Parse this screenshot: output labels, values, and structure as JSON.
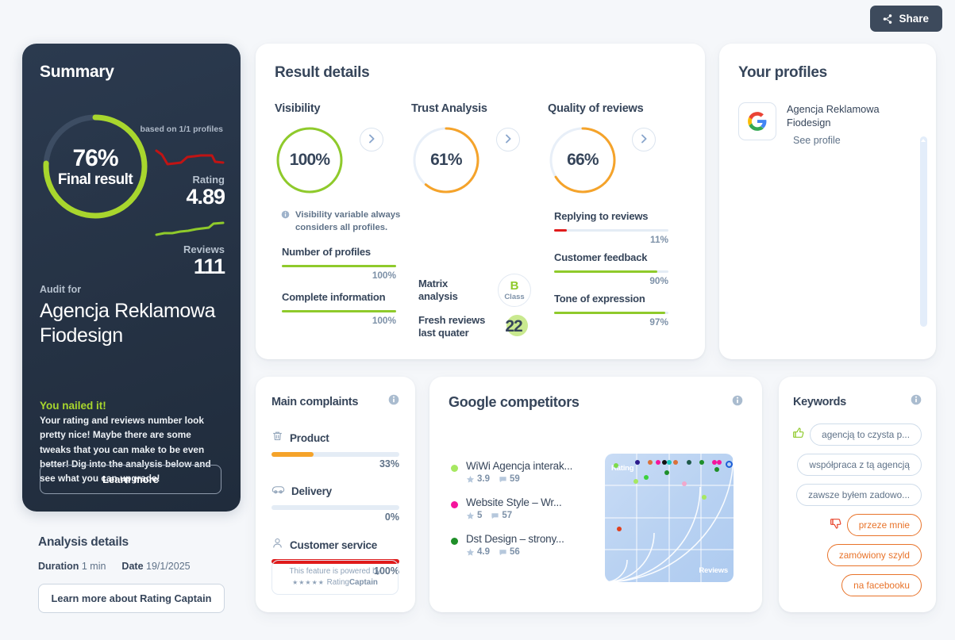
{
  "topbar": {
    "share_label": "Share",
    "share_icon": "share-icon"
  },
  "summary": {
    "title": "Summary",
    "based_on": "based on 1/1 profiles",
    "final_percent": "76%",
    "final_label": "Final result",
    "final_value": 76,
    "rating_label": "Rating",
    "rating_value": "4.89",
    "reviews_label": "Reviews",
    "reviews_value": "111",
    "audit_for_label": "Audit for",
    "audit_name": "Agencja Reklamowa Fiodesign",
    "headline": "You nailed it!",
    "body": "Your rating and reviews number look pretty nice! Maybe there are some tweaks that you can make to be even better! Dig into the analysis below and see what you can upgrade!",
    "learn_more": "Learn more",
    "accent_green": "#a8d62d",
    "card_bg": "#2b3a4f"
  },
  "analysis_details": {
    "title": "Analysis details",
    "duration_label": "Duration",
    "duration_value": "1 min",
    "date_label": "Date",
    "date_value": "19/1/2025",
    "button": "Learn more about Rating Captain"
  },
  "result_details": {
    "title": "Result details",
    "visibility": {
      "title": "Visibility",
      "percent": "100%",
      "value": 100,
      "color": "#8fca2b",
      "note_icon": "info-icon",
      "note": "Visibility variable always considers all profiles.",
      "bars": [
        {
          "label": "Number of profiles",
          "percent": "100%",
          "value": 100,
          "color": "#8fca2b"
        },
        {
          "label": "Complete information",
          "percent": "100%",
          "value": 100,
          "color": "#8fca2b"
        }
      ]
    },
    "trust": {
      "title": "Trust Analysis",
      "percent": "61%",
      "value": 61,
      "color": "#f5a32a",
      "matrix_label": "Matrix analysis",
      "matrix_class_letter": "B",
      "matrix_class_word": "Class",
      "fresh_label": "Fresh reviews last quater",
      "fresh_value": "22"
    },
    "quality": {
      "title": "Quality of reviews",
      "percent": "66%",
      "value": 66,
      "color": "#f5a32a",
      "bars": [
        {
          "label": "Replying to reviews",
          "percent": "11%",
          "value": 11,
          "color": "#e01b1b"
        },
        {
          "label": "Customer feedback",
          "percent": "90%",
          "value": 90,
          "color": "#8fca2b"
        },
        {
          "label": "Tone of expression",
          "percent": "97%",
          "value": 97,
          "color": "#8fca2b"
        }
      ]
    },
    "chevron_icon": "chevron-right-icon"
  },
  "profiles": {
    "title": "Your profiles",
    "items": [
      {
        "logo_icon": "google-icon",
        "name": "Agencja Reklamowa Fiodesign",
        "link": "See profile"
      }
    ]
  },
  "complaints": {
    "title": "Main complaints",
    "info_icon": "info-icon",
    "items": [
      {
        "icon": "trash-icon",
        "label": "Product",
        "percent": "33%",
        "value": 33,
        "color": "#f5a32a"
      },
      {
        "icon": "truck-icon",
        "label": "Delivery",
        "percent": "0%",
        "value": 0,
        "color": "#e4ecf5"
      },
      {
        "icon": "person-icon",
        "label": "Customer service",
        "percent": "100%",
        "value": 100,
        "color": "#e01b1b"
      }
    ],
    "powered_line1": "This feature is powered by",
    "powered_stars": "★★★★★",
    "powered_brand_1": "Rating",
    "powered_brand_2": "Captain"
  },
  "competitors": {
    "title": "Google competitors",
    "info_icon": "info-icon",
    "items": [
      {
        "dot": "#a6e861",
        "name": "WiWi Agencja interak...",
        "rating": "3.9",
        "reviews": "59"
      },
      {
        "dot": "#f5149c",
        "name": "Website Style – Wr...",
        "rating": "5",
        "reviews": "57"
      },
      {
        "dot": "#1f8f29",
        "name": "Dst Design – strony...",
        "rating": "4.9",
        "reviews": "56"
      }
    ],
    "chart_data": {
      "type": "scatter",
      "title": "Google competitors",
      "xlabel": "Reviews",
      "ylabel": "Rating",
      "grid": true,
      "points": [
        {
          "x": 4,
          "y": 95,
          "color": "#7ddb4a"
        },
        {
          "x": 22,
          "y": 98,
          "color": "#2a1a8c"
        },
        {
          "x": 33,
          "y": 98,
          "color": "#d9713a"
        },
        {
          "x": 40,
          "y": 98,
          "color": "#f5149c"
        },
        {
          "x": 45,
          "y": 98,
          "color": "#111111"
        },
        {
          "x": 49,
          "y": 98,
          "color": "#17c4b8"
        },
        {
          "x": 55,
          "y": 98,
          "color": "#d9713a"
        },
        {
          "x": 66,
          "y": 98,
          "color": "#1f5a4a"
        },
        {
          "x": 77,
          "y": 98,
          "color": "#1f8f29"
        },
        {
          "x": 88,
          "y": 98,
          "color": "#f5149c"
        },
        {
          "x": 92,
          "y": 98,
          "color": "#f5149c"
        },
        {
          "x": 90,
          "y": 92,
          "color": "#1f8f29"
        },
        {
          "x": 47,
          "y": 89,
          "color": "#1f8f29"
        },
        {
          "x": 30,
          "y": 85,
          "color": "#3cd13c"
        },
        {
          "x": 21,
          "y": 82,
          "color": "#a6e861"
        },
        {
          "x": 62,
          "y": 80,
          "color": "#f0a8cc"
        },
        {
          "x": 79,
          "y": 68,
          "color": "#a6e861"
        },
        {
          "x": 7,
          "y": 41,
          "color": "#e0401f"
        },
        {
          "x": 99,
          "y": 97,
          "color": "#1d5fd8",
          "hollow": true
        }
      ]
    }
  },
  "keywords": {
    "title": "Keywords",
    "info_icon": "info-icon",
    "positive_icon": "thumbs-up-icon",
    "negative_icon": "thumbs-down-icon",
    "items": [
      {
        "text": "agencją to czysta p...",
        "tone": "positive",
        "show_icon": true
      },
      {
        "text": "współpraca z tą agencją",
        "tone": "positive",
        "show_icon": false
      },
      {
        "text": "zawsze byłem zadowo...",
        "tone": "positive",
        "show_icon": false
      },
      {
        "text": "przeze mnie",
        "tone": "negative",
        "show_icon": true
      },
      {
        "text": "zamówiony szyld",
        "tone": "negative",
        "show_icon": false
      },
      {
        "text": "na facebooku",
        "tone": "negative",
        "show_icon": false
      }
    ]
  }
}
